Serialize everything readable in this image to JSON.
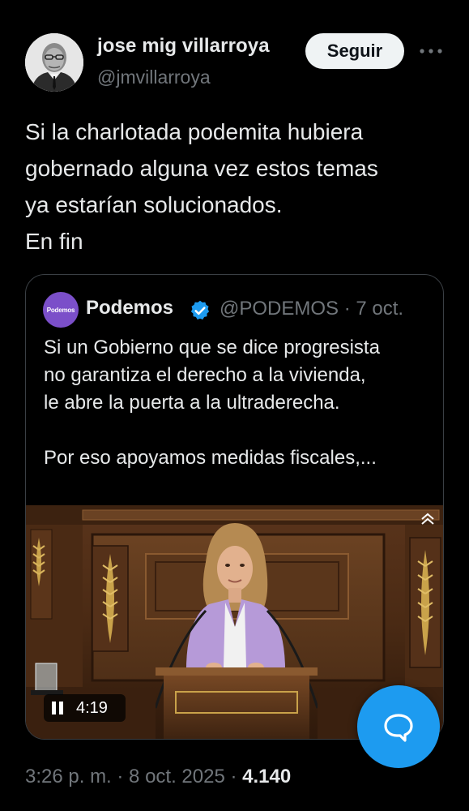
{
  "author": {
    "display_name": "jose mig villarroya",
    "handle": "@jmvillarroya",
    "avatar_icon": "portrait-photo"
  },
  "actions": {
    "follow_label": "Seguir",
    "more_icon": "more-horizontal-icon"
  },
  "tweet": {
    "lines": [
      "Si la charlotada podemita hubiera",
      "gobernado alguna vez estos temas",
      "ya estarían solucionados.",
      "En fin"
    ]
  },
  "quote": {
    "avatar_text": "Podemos",
    "avatar_color": "#7b4fc9",
    "name": "Podemos",
    "verified_icon": "verified-badge-icon",
    "verified_color": "#1d9bf0",
    "handle_date": "@PODEMOS · 7 oct.",
    "lines_top": [
      "Si un Gobierno que se dice progresista",
      "no garantiza el derecho a la vivienda,",
      "le abre la puerta a la ultraderecha."
    ],
    "line_bottom": "Por eso apoyamos medidas fiscales,...",
    "video": {
      "duration": "4:19",
      "state": "playing"
    }
  },
  "meta": {
    "time_date": "3:26 p. m. · 8 oct. 2025 · ",
    "views": "4.140"
  },
  "fab": {
    "icon": "compose-reply-icon",
    "color": "#1d9bf0"
  }
}
